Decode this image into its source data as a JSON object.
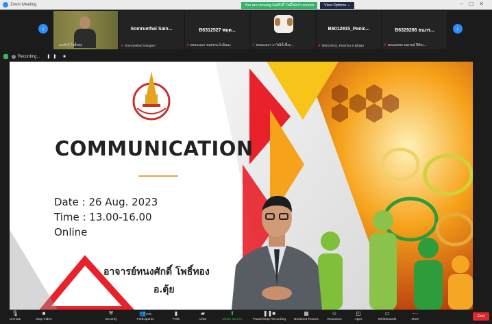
{
  "window": {
    "title": "Zoom Meeting",
    "share_banner": "You are viewing นนศักดิ์ โพธิ์ทอง's screen",
    "view_options": "View Options"
  },
  "participants": [
    {
      "name": "",
      "footer": "นนศักดิ์ โพธิ์ทอง",
      "type": "video"
    },
    {
      "name": "Somruethai  Sain...",
      "footer": "Somruethai Saingam",
      "type": "name"
    },
    {
      "name": "B6312527 พฤต...",
      "footer": "B6312527 พฤตพระน์ เสินนะ",
      "type": "name"
    },
    {
      "name": "",
      "footer": "B6312517 ภาวิณีน้ำผึ้งฤ...",
      "type": "dog"
    },
    {
      "name": "B6012915_Panic...",
      "footer": "B6012915_Panicha S.Bhijan",
      "type": "name"
    },
    {
      "name": "B6329266 ธนภร...",
      "footer": "B6329266 ธนภรณ์ ปิติพะ...",
      "type": "name"
    }
  ],
  "recording": {
    "label": "Recording...",
    "controls": "❚❚ ■"
  },
  "slide": {
    "title": "COMMUNICATION",
    "date": "Date  : 26 Aug. 2023",
    "time": "Time  : 13.00-16.00",
    "mode": "Online",
    "teacher": "อาจารย์ทนงศักดิ์  โพธิ์ทอง",
    "nickname": "อ.ตุ้ย"
  },
  "toolbar": {
    "unmute": "Unmute",
    "stop_video": "Stop Video",
    "security": "Security",
    "participants": "Participants",
    "participants_count": "275",
    "polls": "Polls",
    "chat": "Chat",
    "share_screen": "Share Screen",
    "pause_recording": "Pause/Stop Recording",
    "breakout": "Breakout Rooms",
    "reactions": "Reactions",
    "apps": "Apps",
    "whiteboards": "Whiteboards",
    "more": "More",
    "end": "End"
  },
  "colors": {
    "accent": "#2d8cff",
    "share_green": "#36b36b",
    "end_red": "#e02828",
    "slide_red": "#e02a1e",
    "slide_orange": "#f6a21a",
    "slide_yellow": "#f7c51a"
  }
}
